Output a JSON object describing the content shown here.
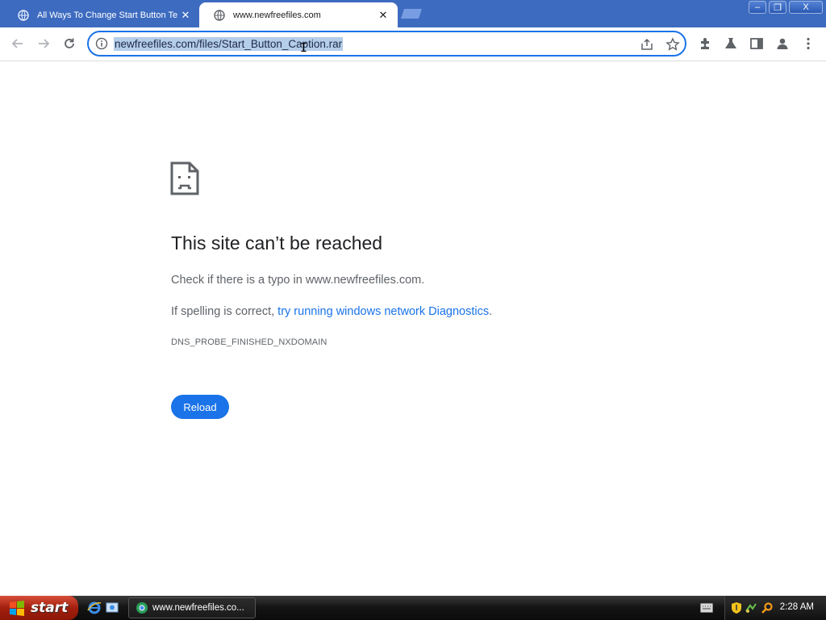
{
  "browser": {
    "tabs": [
      {
        "title": "All Ways To Change Start Button Te",
        "active": false
      },
      {
        "title": "www.newfreefiles.com",
        "active": true
      }
    ],
    "close_glyph": "✕",
    "window_controls": {
      "minimize": "–",
      "restore": "❐",
      "close": "X"
    },
    "address_bar": {
      "url": "newfreefiles.com/files/Start_Button_Caption.rar",
      "url_selected": true
    },
    "accent_color": "#1a73e8",
    "tabstrip_color": "#3d6bc0"
  },
  "error_page": {
    "heading": "This site can’t be reached",
    "line1": "Check if there is a typo in www.newfreefiles.com.",
    "line2_prefix": "If spelling is correct, ",
    "line2_link": "try running windows network Diagnostics",
    "line2_suffix": ".",
    "error_code": "DNS_PROBE_FINISHED_NXDOMAIN",
    "reload_label": "Reload"
  },
  "taskbar": {
    "start_label": "start",
    "task_item": "www.newfreefiles.co...",
    "clock": "2:28 AM"
  }
}
